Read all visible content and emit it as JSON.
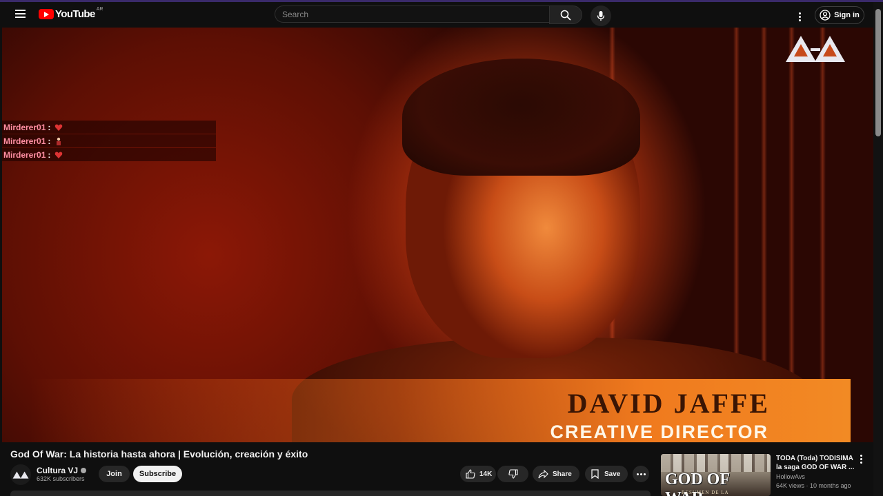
{
  "header": {
    "logo_text": "YouTube",
    "region": "AR",
    "search_placeholder": "Search",
    "signin_label": "Sign in"
  },
  "player": {
    "lower_third_name": "DAVID JAFFE",
    "lower_third_role": "CREATIVE DIRECTOR",
    "chat": [
      {
        "user": "Mirderer01",
        "sep": ":"
      },
      {
        "user": "Mirderer01",
        "sep": ":"
      },
      {
        "user": "Mirderer01",
        "sep": ":"
      }
    ]
  },
  "video": {
    "title": "God Of War: La historia hasta ahora | Evolución, creación y éxito",
    "channel": "Cultura VJ",
    "subscribers": "632K subscribers",
    "join_label": "Join",
    "subscribe_label": "Subscribe",
    "likes": "14K",
    "share_label": "Share",
    "save_label": "Save"
  },
  "recommended": [
    {
      "title": "TODA (Toda) TODISIMA la saga GOD OF WAR ...",
      "channel": "HollowAvs",
      "meta": "64K views · 10 months ago",
      "thumb_text": "GOD OF WAR",
      "thumb_sub": "RESUMEN DE LA"
    }
  ],
  "colors": {
    "background": "#0f0f0f",
    "brand_red": "#ff0000",
    "chat_user": "#ff8fa3",
    "pill": "#272727"
  }
}
